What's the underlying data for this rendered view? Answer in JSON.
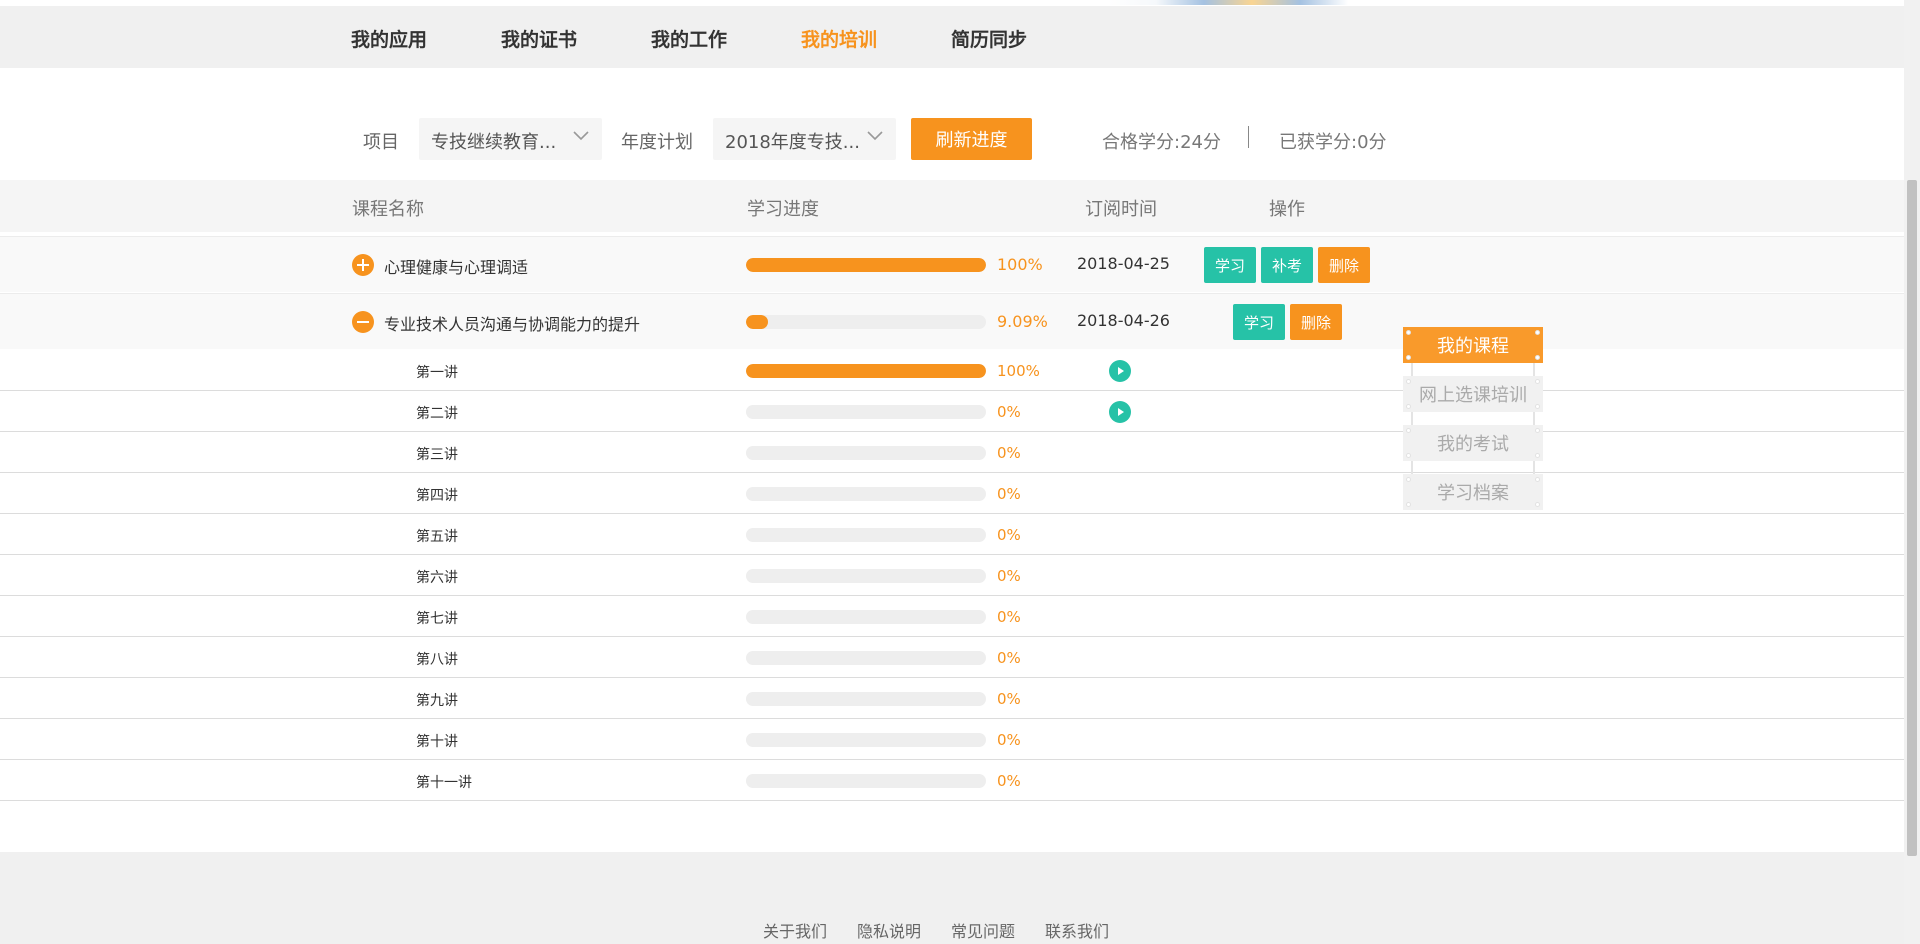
{
  "nav": {
    "items": [
      {
        "label": "我的应用",
        "active": false
      },
      {
        "label": "我的证书",
        "active": false
      },
      {
        "label": "我的工作",
        "active": false
      },
      {
        "label": "我的培训",
        "active": true
      },
      {
        "label": "简历同步",
        "active": false
      }
    ]
  },
  "filters": {
    "project_label": "项目",
    "project_value": "专技继续教育...",
    "plan_label": "年度计划",
    "plan_value": "2018年度专技...",
    "refresh_label": "刷新进度",
    "required_credits": "合格学分:24分",
    "earned_credits": "已获学分:0分"
  },
  "table": {
    "headers": [
      "课程名称",
      "学习进度",
      "订阅时间",
      "操作"
    ],
    "courses": [
      {
        "name": "心理健康与心理调适",
        "progress": 100,
        "progress_text": "100%",
        "date": "2018-04-25",
        "expanded": false,
        "actions": [
          "学习",
          "补考",
          "删除"
        ]
      },
      {
        "name": "专业技术人员沟通与协调能力的提升",
        "progress": 9.09,
        "progress_text": "9.09%",
        "date": "2018-04-26",
        "expanded": true,
        "actions": [
          "学习",
          "删除"
        ],
        "lessons": [
          {
            "name": "第一讲",
            "progress": 100,
            "progress_text": "100%",
            "playable": true
          },
          {
            "name": "第二讲",
            "progress": 0,
            "progress_text": "0%",
            "playable": true
          },
          {
            "name": "第三讲",
            "progress": 0,
            "progress_text": "0%",
            "playable": false
          },
          {
            "name": "第四讲",
            "progress": 0,
            "progress_text": "0%",
            "playable": false
          },
          {
            "name": "第五讲",
            "progress": 0,
            "progress_text": "0%",
            "playable": false
          },
          {
            "name": "第六讲",
            "progress": 0,
            "progress_text": "0%",
            "playable": false
          },
          {
            "name": "第七讲",
            "progress": 0,
            "progress_text": "0%",
            "playable": false
          },
          {
            "name": "第八讲",
            "progress": 0,
            "progress_text": "0%",
            "playable": false
          },
          {
            "name": "第九讲",
            "progress": 0,
            "progress_text": "0%",
            "playable": false
          },
          {
            "name": "第十讲",
            "progress": 0,
            "progress_text": "0%",
            "playable": false
          },
          {
            "name": "第十一讲",
            "progress": 0,
            "progress_text": "0%",
            "playable": false
          }
        ]
      }
    ]
  },
  "side_menu": {
    "items": [
      {
        "label": "我的课程",
        "active": true
      },
      {
        "label": "网上选课培训",
        "active": false
      },
      {
        "label": "我的考试",
        "active": false
      },
      {
        "label": "学习档案",
        "active": false
      }
    ]
  },
  "footer": {
    "links": [
      "关于我们",
      "隐私说明",
      "常见问题",
      "联系我们"
    ]
  },
  "colors": {
    "accent": "#f7931e",
    "teal": "#26c2a7",
    "nav_bg": "#f0f0f0",
    "track": "#eeeeee"
  }
}
